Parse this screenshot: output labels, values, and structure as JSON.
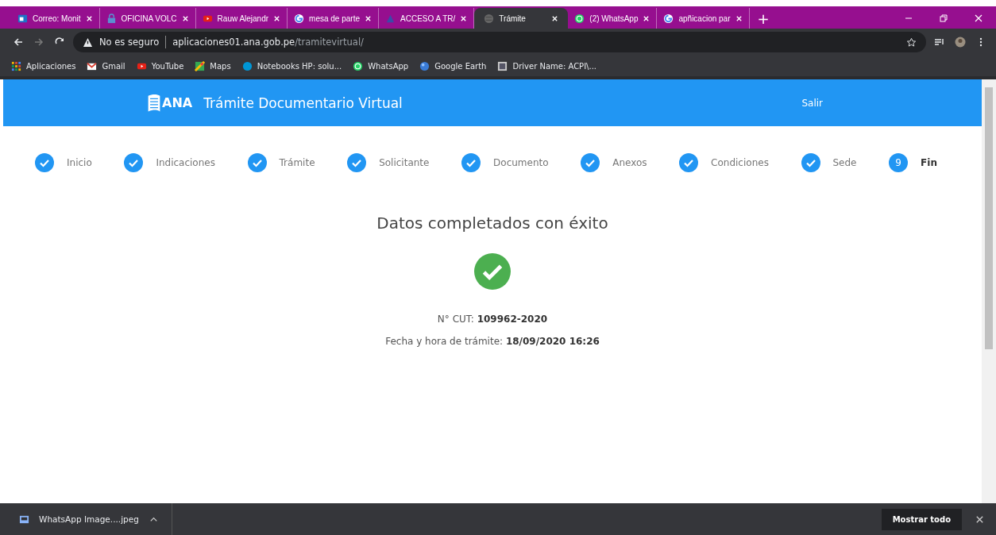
{
  "browser": {
    "tabs": [
      {
        "title": "Correo: Monit",
        "selected": false
      },
      {
        "title": "OFICINA VOLC",
        "selected": false
      },
      {
        "title": "Rauw Alejandr",
        "selected": false
      },
      {
        "title": "mesa de parte",
        "selected": false
      },
      {
        "title": "ACCESO A TR/",
        "selected": false
      },
      {
        "title": "Trámite",
        "selected": true
      },
      {
        "title": "(2) WhatsApp",
        "selected": false
      },
      {
        "title": "apñicacion par",
        "selected": false
      }
    ],
    "new_tab": "+",
    "security": "No es seguro",
    "url_host": "aplicaciones01.ana.gob.pe",
    "url_path": "/tramitevirtual/",
    "bookmarks": [
      {
        "label": "Aplicaciones"
      },
      {
        "label": "Gmail"
      },
      {
        "label": "YouTube"
      },
      {
        "label": "Maps"
      },
      {
        "label": "Notebooks HP: solu..."
      },
      {
        "label": "WhatsApp"
      },
      {
        "label": "Google Earth"
      },
      {
        "label": "Driver Name: ACPI\\..."
      }
    ]
  },
  "header": {
    "logo": "ANA",
    "title": "Trámite Documentario Virtual",
    "logout": "Salir"
  },
  "steps": [
    {
      "label": "Inicio",
      "completed": true,
      "active": false
    },
    {
      "label": "Indicaciones",
      "completed": true,
      "active": false
    },
    {
      "label": "Trámite",
      "completed": true,
      "active": false
    },
    {
      "label": "Solicitante",
      "completed": true,
      "active": false
    },
    {
      "label": "Documento",
      "completed": true,
      "active": false
    },
    {
      "label": "Anexos",
      "completed": true,
      "active": false
    },
    {
      "label": "Condiciones",
      "completed": true,
      "active": false
    },
    {
      "label": "Sede",
      "completed": true,
      "active": false
    },
    {
      "label": "Fin",
      "completed": false,
      "number": "9",
      "active": true
    }
  ],
  "result": {
    "heading": "Datos completados con éxito",
    "cut_label": "N° CUT:",
    "cut_value": "109962-2020",
    "date_label": "Fecha y hora de trámite:",
    "date_value": "18/09/2020 16:26"
  },
  "downloads": {
    "file": "WhatsApp Image....jpeg",
    "show_all": "Mostrar todo"
  }
}
